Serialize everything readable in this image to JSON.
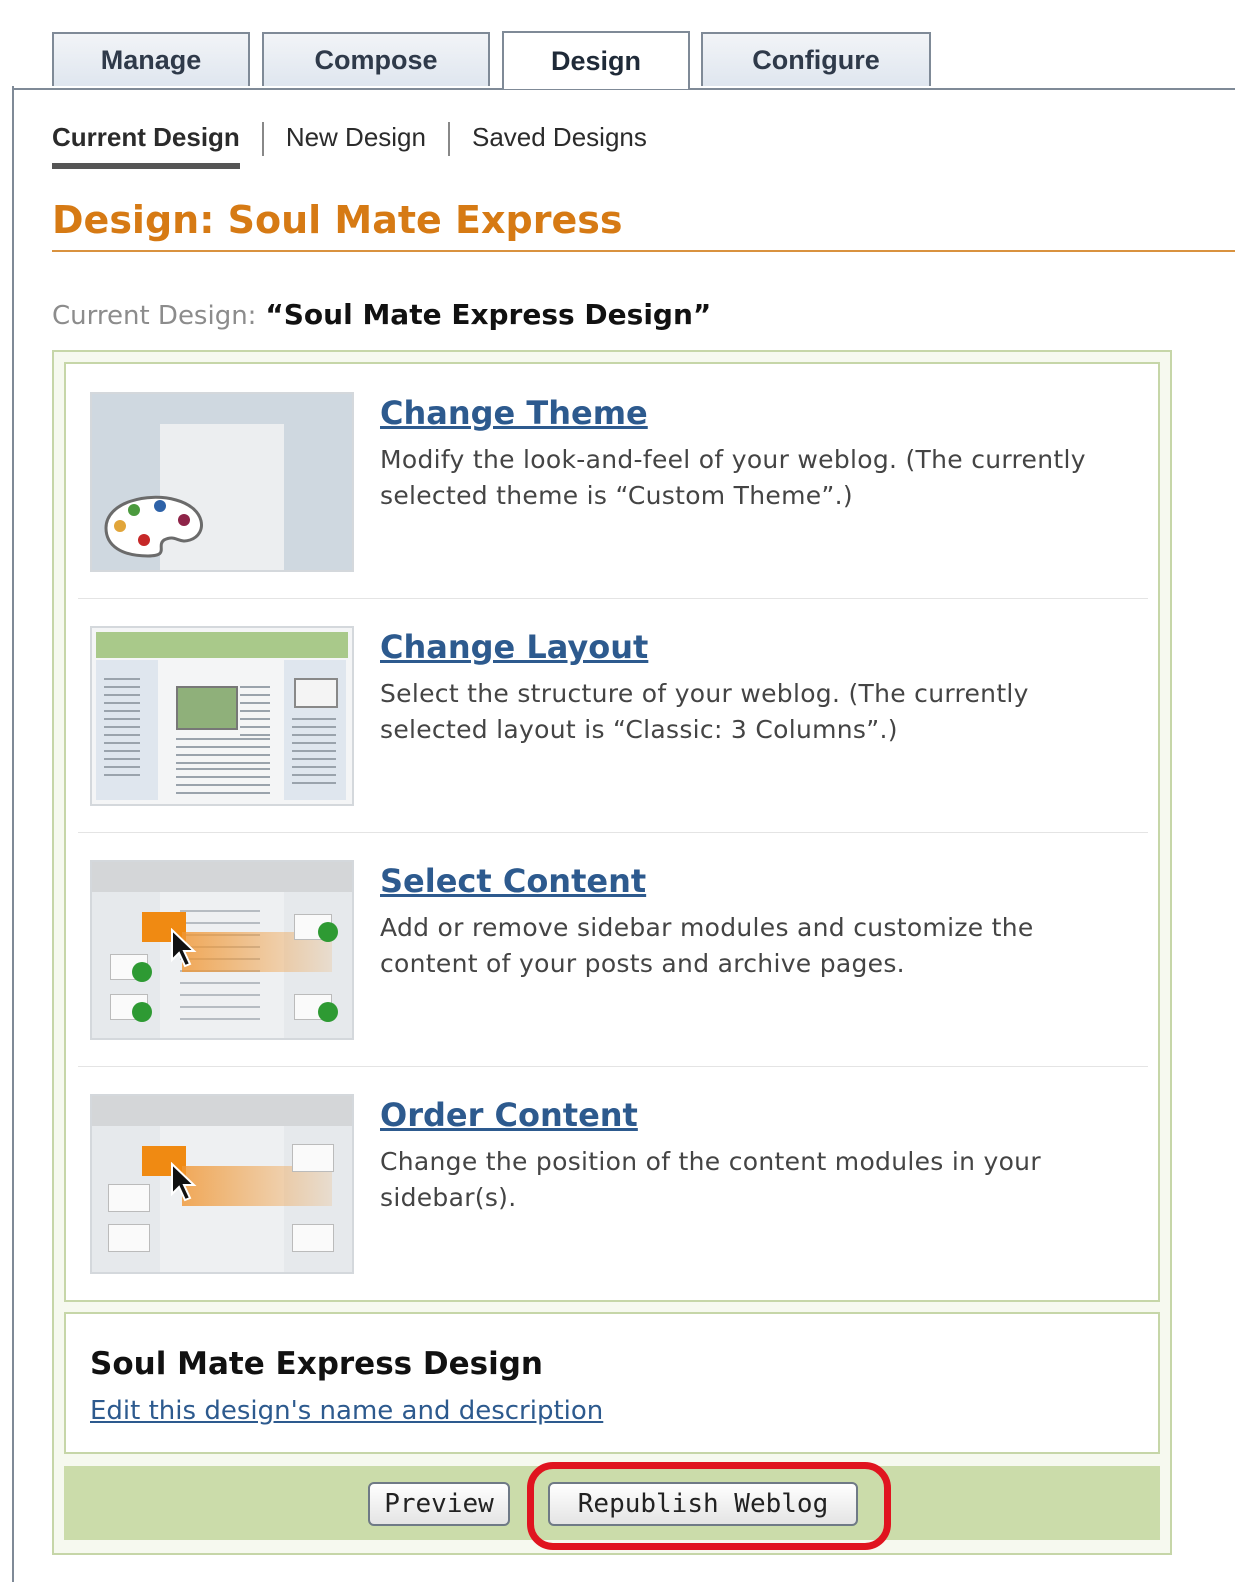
{
  "tabs": [
    {
      "label": "Manage"
    },
    {
      "label": "Compose"
    },
    {
      "label": "Design"
    },
    {
      "label": "Configure"
    }
  ],
  "subnav": {
    "current": "Current Design",
    "new": "New Design",
    "saved": "Saved Designs"
  },
  "page_title": "Design: Soul Mate Express",
  "current_design": {
    "label": "Current Design:",
    "value": "“Soul Mate Express Design”"
  },
  "options": [
    {
      "title": "Change Theme",
      "description": "Modify the look-and-feel of your weblog. (The currently selected theme is “Custom Theme”.)",
      "icon": "palette-icon"
    },
    {
      "title": "Change Layout",
      "description": "Select the structure of your weblog. (The currently selected layout is “Classic: 3 Columns”.)",
      "icon": "layout-icon"
    },
    {
      "title": "Select Content",
      "description": "Add or remove sidebar modules and customize the content of your posts and archive pages.",
      "icon": "select-content-icon"
    },
    {
      "title": "Order Content",
      "description": "Change the position of the content modules in your sidebar(s).",
      "icon": "order-content-icon"
    }
  ],
  "design_info": {
    "name": "Soul Mate Express Design",
    "edit_link": "Edit this design's name and description"
  },
  "buttons": {
    "preview": "Preview",
    "republish": "Republish Weblog"
  },
  "colors": {
    "accent_orange": "#d67a14",
    "link_blue": "#2d5a8e",
    "panel_border": "#c6d6a8",
    "action_bar": "#cbdcaa",
    "highlight_red": "#e0141f"
  }
}
